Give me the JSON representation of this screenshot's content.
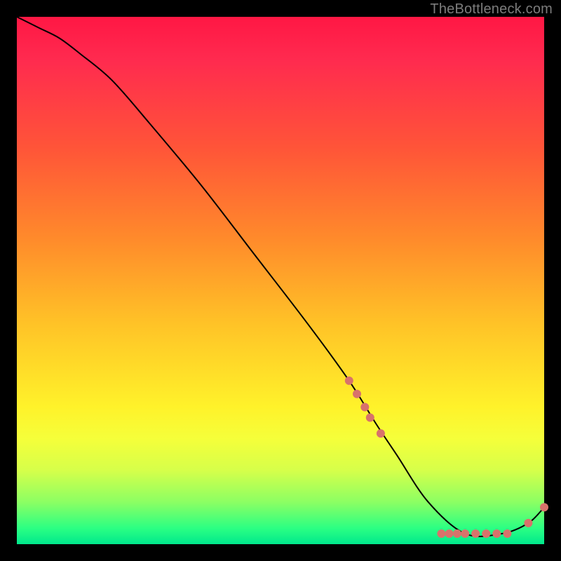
{
  "attribution": "TheBottleneck.com",
  "chart_data": {
    "type": "line",
    "title": "",
    "xlabel": "",
    "ylabel": "",
    "xlim": [
      0,
      100
    ],
    "ylim": [
      0,
      100
    ],
    "background_gradient": [
      "#ff1744",
      "#ff5538",
      "#ffc227",
      "#fff22a",
      "#2bff83",
      "#00e88c"
    ],
    "series": [
      {
        "name": "bottleneck-curve",
        "color": "#000000",
        "x": [
          0,
          4,
          8,
          12,
          18,
          25,
          35,
          45,
          55,
          63,
          68,
          72,
          78,
          85,
          92,
          97,
          100
        ],
        "y": [
          100,
          98,
          96,
          93,
          88,
          80,
          68,
          55,
          42,
          31,
          23,
          17,
          8,
          2,
          2,
          4,
          7
        ]
      }
    ],
    "markers": {
      "name": "highlight-points",
      "color": "#d8726b",
      "radius": 6,
      "points": [
        {
          "x": 63,
          "y": 31
        },
        {
          "x": 64.5,
          "y": 28.5
        },
        {
          "x": 66,
          "y": 26
        },
        {
          "x": 67,
          "y": 24
        },
        {
          "x": 69,
          "y": 21
        },
        {
          "x": 80.5,
          "y": 2
        },
        {
          "x": 82,
          "y": 2
        },
        {
          "x": 83.5,
          "y": 2
        },
        {
          "x": 85,
          "y": 2
        },
        {
          "x": 87,
          "y": 2
        },
        {
          "x": 89,
          "y": 2
        },
        {
          "x": 91,
          "y": 2
        },
        {
          "x": 93,
          "y": 2
        },
        {
          "x": 97,
          "y": 4
        },
        {
          "x": 100,
          "y": 7
        }
      ]
    }
  }
}
